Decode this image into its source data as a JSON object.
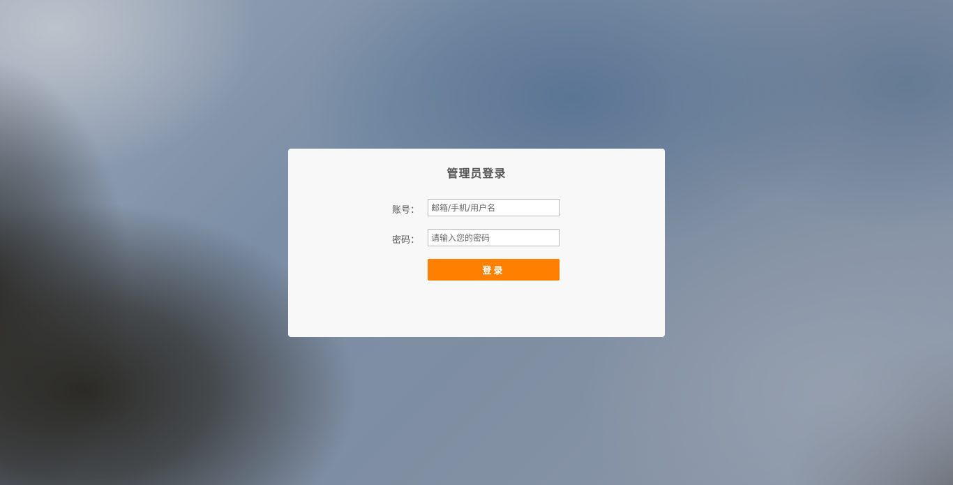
{
  "login": {
    "title": "管理员登录",
    "account": {
      "label": "账号：",
      "placeholder": "邮箱/手机/用户名",
      "value": ""
    },
    "password": {
      "label": "密码：",
      "placeholder": "请输入您的密码",
      "value": ""
    },
    "submit_label": "登录"
  },
  "colors": {
    "accent": "#ff8000",
    "card_background": "#f8f8f8",
    "label_text": "#555555"
  }
}
